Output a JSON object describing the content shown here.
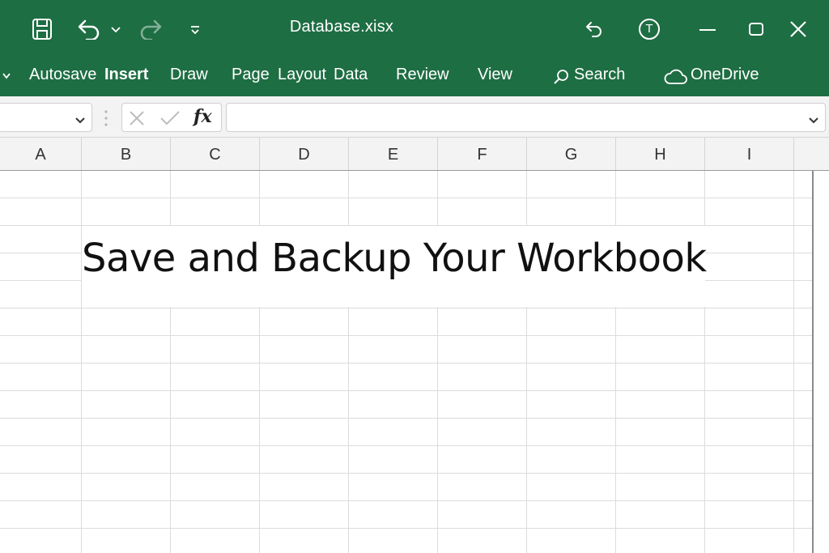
{
  "titlebar": {
    "title": "Database.xisx",
    "icons": [
      "save-icon",
      "undo-icon",
      "undo-dropdown-icon",
      "redo-icon",
      "customize-qat-icon",
      "undo-right-icon",
      "account-icon",
      "minimize-icon",
      "maximize-icon",
      "close-icon"
    ],
    "account_initial": "T"
  },
  "ribbon": {
    "items": [
      {
        "label": "Autosave",
        "bold": false
      },
      {
        "label": "Insert",
        "bold": true
      },
      {
        "label": "Draw",
        "bold": false
      },
      {
        "label": "Page",
        "bold": false
      },
      {
        "label": "Layout",
        "bold": false
      },
      {
        "label": "Data",
        "bold": false
      },
      {
        "label": "Review",
        "bold": false
      },
      {
        "label": "View",
        "bold": false
      }
    ],
    "search_label": "Search",
    "onedrive_label": "OneDrive"
  },
  "formula_bar": {
    "name_box_value": "",
    "fx_label": "fx",
    "formula_value": ""
  },
  "columns": [
    "A",
    "B",
    "C",
    "D",
    "E",
    "F",
    "G",
    "H",
    "I"
  ],
  "sheet": {
    "merged_cell_text": "Save and Backup Your Workbook"
  },
  "colors": {
    "ribbon_green": "#1e6e43",
    "header_bg": "#f3f3f3",
    "grid_line": "#dcdcdc"
  }
}
